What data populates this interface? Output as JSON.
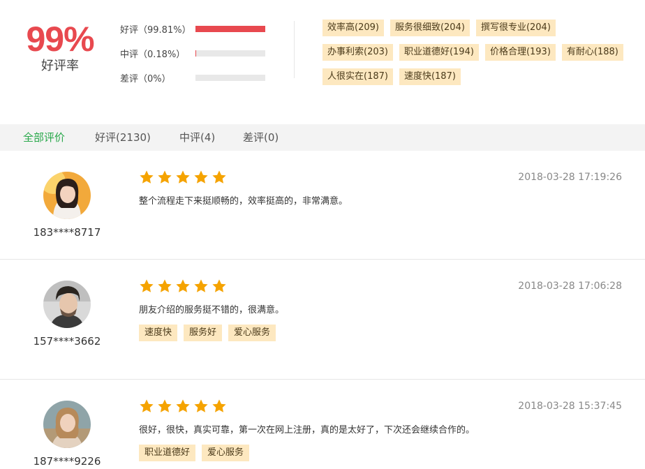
{
  "summary": {
    "rate_value": "99%",
    "rate_label": "好评率",
    "bars": [
      {
        "label": "好评（99.81%）",
        "fraction": 0.9981
      },
      {
        "label": "中评（0.18%）",
        "fraction": 0.0018
      },
      {
        "label": "差评（0%）",
        "fraction": 0
      }
    ],
    "tags": [
      "效率高(209)",
      "服务很细致(204)",
      "撰写很专业(204)",
      "办事利索(203)",
      "职业道德好(194)",
      "价格合理(193)",
      "有耐心(188)",
      "人很实在(187)",
      "速度快(187)"
    ]
  },
  "tabs": [
    {
      "label": "全部评价",
      "active": true
    },
    {
      "label": "好评(2130)",
      "active": false
    },
    {
      "label": "中评(4)",
      "active": false
    },
    {
      "label": "差评(0)",
      "active": false
    }
  ],
  "reviews": [
    {
      "username": "183****8717",
      "rating": 5,
      "date": "2018-03-28 17:19:26",
      "content": "整个流程走下来挺顺畅的，效率挺高的，非常满意。",
      "tags": []
    },
    {
      "username": "157****3662",
      "rating": 5,
      "date": "2018-03-28 17:06:28",
      "content": "朋友介绍的服务挺不错的，很满意。",
      "tags": [
        "速度快",
        "服务好",
        "爱心服务"
      ]
    },
    {
      "username": "187****9226",
      "rating": 5,
      "date": "2018-03-28 15:37:45",
      "content": "很好，很快，真实可靠，第一次在网上注册，真的是太好了，下次还会继续合作的。",
      "tags": [
        "职业道德好",
        "爱心服务"
      ]
    }
  ],
  "colors": {
    "accent_red": "#e8494f",
    "active_tab_green": "#28a84a",
    "tag_bg": "#fde8c0",
    "star": "#f5a300"
  },
  "icons": {
    "star": "star-icon",
    "avatar": "avatar"
  }
}
